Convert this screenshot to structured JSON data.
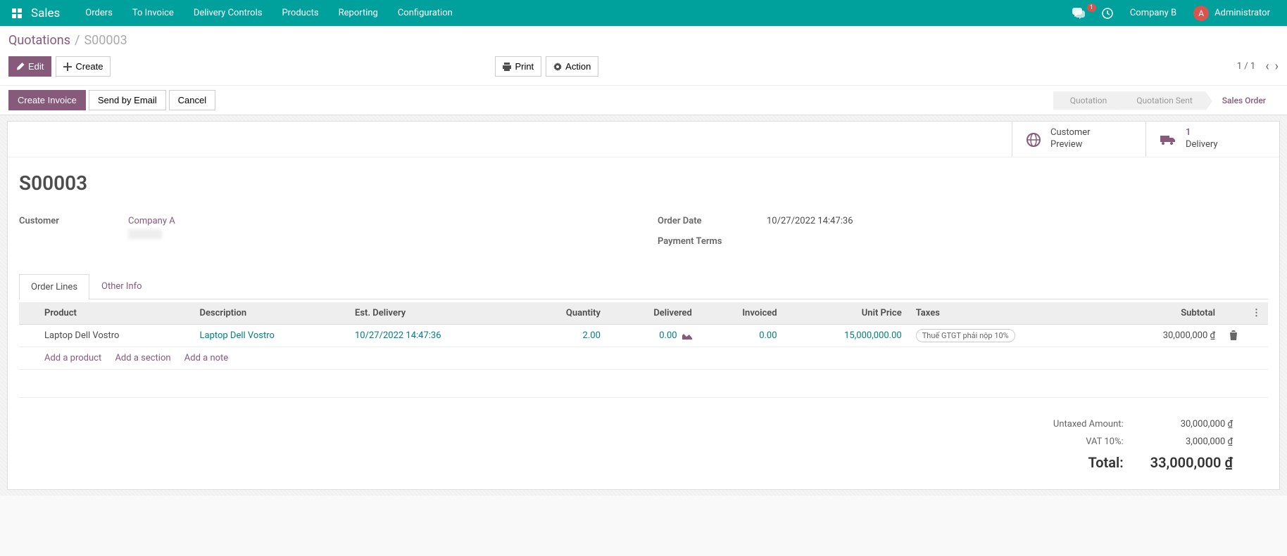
{
  "topnav": {
    "brand": "Sales",
    "items": [
      "Orders",
      "To Invoice",
      "Delivery Controls",
      "Products",
      "Reporting",
      "Configuration"
    ],
    "msg_badge": "1",
    "company": "Company B",
    "avatar_initial": "A",
    "user": "Administrator"
  },
  "breadcrumb": {
    "root": "Quotations",
    "current": "S00003"
  },
  "actions": {
    "edit": "Edit",
    "create": "Create",
    "print": "Print",
    "action": "Action",
    "pager": "1 / 1"
  },
  "status": {
    "buttons": [
      "Create Invoice",
      "Send by Email",
      "Cancel"
    ],
    "steps": [
      "Quotation",
      "Quotation Sent",
      "Sales Order"
    ],
    "active_step": 2
  },
  "stat_buttons": [
    {
      "icon": "globe",
      "line1": "Customer",
      "line2": "Preview"
    },
    {
      "icon": "truck",
      "num": "1",
      "label": "Delivery"
    }
  ],
  "record": {
    "title": "S00003",
    "fields_left": {
      "customer_label": "Customer",
      "customer_value": "Company A"
    },
    "fields_right": {
      "order_date_label": "Order Date",
      "order_date_value": "10/27/2022 14:47:36",
      "payment_terms_label": "Payment Terms",
      "payment_terms_value": ""
    }
  },
  "tabs": [
    "Order Lines",
    "Other Info"
  ],
  "lines": {
    "headers": [
      "Product",
      "Description",
      "Est. Delivery",
      "Quantity",
      "Delivered",
      "Invoiced",
      "Unit Price",
      "Taxes",
      "Subtotal"
    ],
    "rows": [
      {
        "product": "Laptop Dell Vostro",
        "description": "Laptop Dell Vostro",
        "est_delivery": "10/27/2022 14:47:36",
        "quantity": "2.00",
        "delivered": "0.00",
        "invoiced": "0.00",
        "unit_price": "15,000,000.00",
        "tax": "Thuế GTGT phải nộp 10%",
        "subtotal": "30,000,000 ₫"
      }
    ],
    "add_product": "Add a product",
    "add_section": "Add a section",
    "add_note": "Add a note"
  },
  "totals": {
    "untaxed_label": "Untaxed Amount:",
    "untaxed_value": "30,000,000 ₫",
    "vat_label": "VAT 10%:",
    "vat_value": "3,000,000 ₫",
    "total_label": "Total:",
    "total_value": "33,000,000 ₫"
  }
}
